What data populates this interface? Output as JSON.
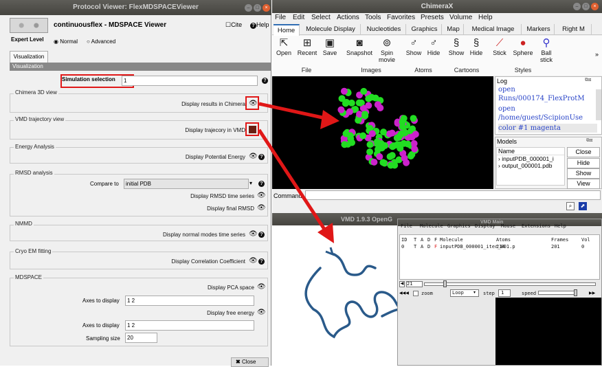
{
  "protocol_viewer": {
    "title": "Protocol Viewer: FlexMDSPACEViewer",
    "name": "continuousflex - MDSPACE Viewer",
    "cite": "Cite",
    "help": "Help",
    "expert_level_label": "Expert Level",
    "expert_options": [
      "Normal",
      "Advanced"
    ],
    "expert_selected": "Normal",
    "tab": "Visualization",
    "section_header": "Visualization",
    "sim_selection_label": "Simulation selection",
    "sim_selection_value": "1",
    "chimera_section": "Chimera 3D view",
    "chimera_btn": "Display results in Chimera",
    "vmd_section": "VMD trajectory view",
    "vmd_btn": "Display trajecory in VMD",
    "energy_section": "Energy Analysis",
    "energy_btn": "Display Potential Energy",
    "rmsd_section": "RMSD analysis",
    "compare_label": "Compare to",
    "compare_value": "initial PDB",
    "rmsd_ts_btn": "Display RMSD time series",
    "rmsd_final_btn": "Display final RMSD",
    "nmmd_section": "NMMD",
    "nmmd_btn": "Display normal modes time series",
    "cryo_section": "Cryo EM fitting",
    "cryo_btn": "Display Correlation Coefficient",
    "mdspace_section": "MDSPACE",
    "pca_btn": "Display PCA space",
    "axes_label_1": "Axes to display",
    "axes_value_1": "1 2",
    "free_energy_btn": "Display free energy",
    "axes_label_2": "Axes to display",
    "axes_value_2": "1 2",
    "sampling_label": "Sampling size",
    "sampling_value": "20",
    "close": "Close"
  },
  "chimerax": {
    "title": "ChimeraX",
    "menu": [
      "File",
      "Edit",
      "Select",
      "Actions",
      "Tools",
      "Favorites",
      "Presets",
      "Volume",
      "Help"
    ],
    "tabs": [
      "Home",
      "Molecule Display",
      "Nucleotides",
      "Graphics",
      "Map",
      "Medical Image",
      "Markers",
      "Right M"
    ],
    "tools": [
      {
        "label": "Open",
        "icon": "open-icon"
      },
      {
        "label": "Recent",
        "icon": "recent-icon"
      },
      {
        "label": "Save",
        "icon": "save-icon"
      },
      {
        "label": "Snapshot",
        "icon": "camera-icon"
      },
      {
        "label": "Spin movie",
        "icon": "film-icon"
      },
      {
        "label": "Show",
        "icon": "atom-show-icon"
      },
      {
        "label": "Hide",
        "icon": "atom-hide-icon"
      },
      {
        "label": "Show",
        "icon": "cartoon-show-icon"
      },
      {
        "label": "Hide",
        "icon": "cartoon-hide-icon"
      },
      {
        "label": "Stick",
        "icon": "stick-icon"
      },
      {
        "label": "Sphere",
        "icon": "sphere-icon"
      },
      {
        "label": "Ball stick",
        "icon": "ball-stick-icon"
      }
    ],
    "groups": [
      "File",
      "Images",
      "Atoms",
      "Cartoons",
      "Styles"
    ],
    "log_title": "Log",
    "log_lines": [
      "open Runs/000174_FlexProtM",
      "open /home/guest/ScipionUse",
      "color #1 magenta"
    ],
    "models_title": "Models",
    "models_col": "Name",
    "models": [
      "inputPDB_000001_i",
      "output_000001.pdb"
    ],
    "model_buttons": [
      "Close",
      "Hide",
      "Show",
      "View"
    ],
    "command_label": "Command:"
  },
  "vmd": {
    "display_title": "VMD 1.9.3 OpenG",
    "main_title": "VMD Main",
    "menu": [
      "File",
      "Molecule",
      "Graphics",
      "Display",
      "Mouse",
      "Extensions",
      "Help"
    ],
    "headers": [
      "ID",
      "T",
      "A",
      "D",
      "F",
      "Molecule",
      "Atoms",
      "Frames",
      "Vol"
    ],
    "row": [
      "0",
      "T",
      "A",
      "D",
      "F",
      "inputPDB_000001_iter_001.p",
      "214",
      "201",
      "0"
    ],
    "frame": "21",
    "zoom": "zoom",
    "loop": "Loop",
    "step_label": "step",
    "step": "1",
    "speed": "speed"
  },
  "colors": {
    "annotation": "#e01717",
    "chimerax_tab_accent": "#2f6db3",
    "atom_green": "#22dd22",
    "atom_magenta": "#cc22cc",
    "vmd_ribbon": "#2a5a8a"
  }
}
